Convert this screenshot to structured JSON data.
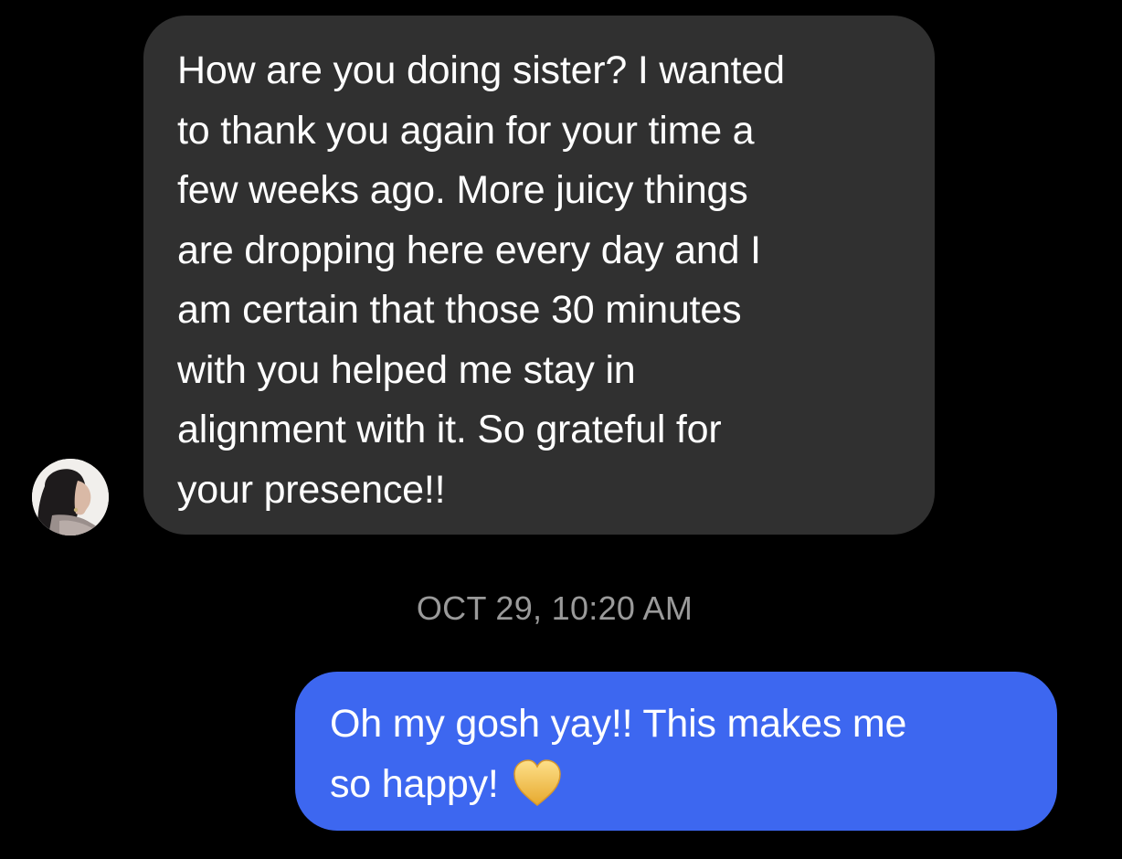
{
  "conversation": {
    "incoming": {
      "lines": [
        "How are you doing sister? I wanted",
        "to thank you again for your time a",
        "few weeks ago. More juicy things",
        "are dropping here every day and I",
        "am certain that those 30 minutes",
        "with you helped me stay in",
        "alignment with it. So grateful for",
        "your presence!!"
      ],
      "bubble_color": "#303030"
    },
    "timestamp": "OCT 29, 10:20 AM",
    "outgoing": {
      "lines": [
        "Oh my gosh yay!! This makes me",
        "so happy!"
      ],
      "emoji": "yellow-heart",
      "bubble_color": "#3d67f0"
    }
  },
  "colors": {
    "background": "#000000",
    "text": "#ffffff",
    "timestamp": "#9a9a9a",
    "heart": "#f6c445"
  }
}
